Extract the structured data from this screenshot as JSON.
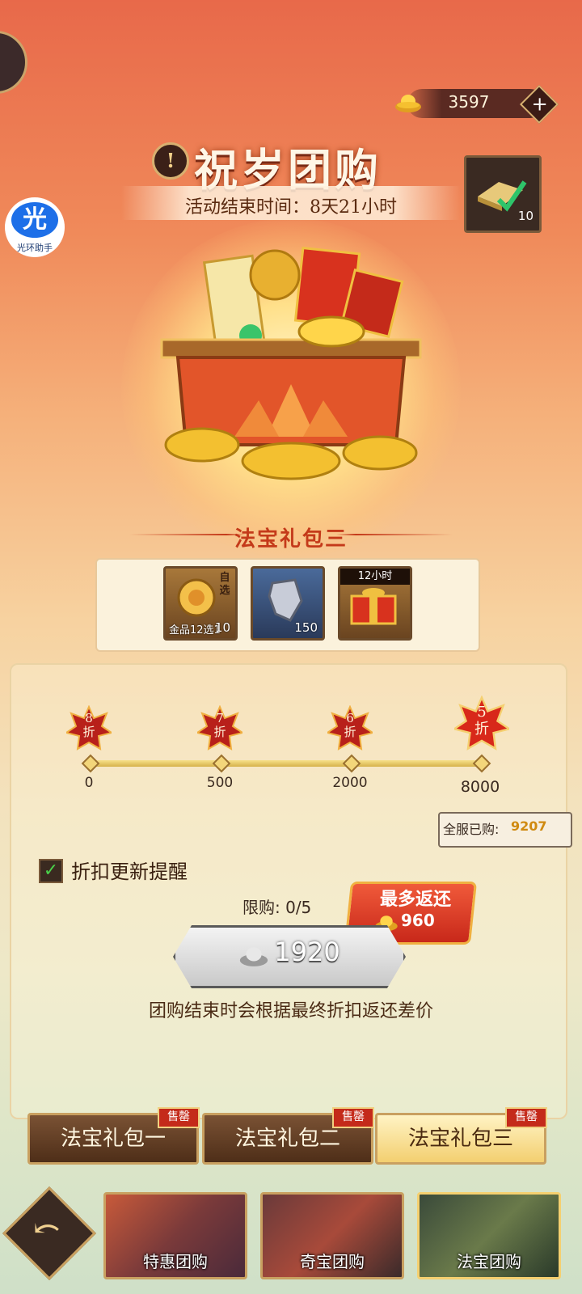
{
  "currency": {
    "value": "3597",
    "add_label": "+"
  },
  "header": {
    "info_label": "!",
    "title": "祝岁团购",
    "end_time": "活动结束时间：8天21小时"
  },
  "top_item": {
    "count": "10"
  },
  "assistant": {
    "icon_char": "光",
    "label": "光环助手"
  },
  "pack": {
    "title": "法宝礼包三",
    "items": [
      {
        "name": "gold-medal-selectable",
        "tag": "金品12选1",
        "corner": "自选",
        "count": "10"
      },
      {
        "name": "spirit-stone",
        "count": "150"
      },
      {
        "name": "red-gift-box",
        "top_label": "12小时"
      }
    ]
  },
  "discount": {
    "tiers": [
      {
        "rate": "8",
        "unit": "折",
        "threshold": "0"
      },
      {
        "rate": "7",
        "unit": "折",
        "threshold": "500"
      },
      {
        "rate": "6",
        "unit": "折",
        "threshold": "2000"
      },
      {
        "rate": "5",
        "unit": "折",
        "threshold": "8000"
      }
    ],
    "sold_label": "全服已购:",
    "sold_value": "9207"
  },
  "remind": {
    "checked": true,
    "label": "折扣更新提醒"
  },
  "purchase": {
    "limit": "限购: 0/5",
    "price": "1920",
    "refund_title": "最多返还",
    "refund_value": "960",
    "note": "团购结束时会根据最终折扣返还差价"
  },
  "pack_tabs": [
    {
      "label": "法宝礼包一",
      "badge": "售罄"
    },
    {
      "label": "法宝礼包二",
      "badge": "售罄"
    },
    {
      "label": "法宝礼包三",
      "badge": "售罄",
      "active": true
    }
  ],
  "nav_tabs": [
    {
      "label": "特惠团购"
    },
    {
      "label": "奇宝团购"
    },
    {
      "label": "法宝团购",
      "active": true
    }
  ],
  "colors": {
    "accent_red": "#c43a1a",
    "gold": "#f0b040",
    "sold_value": "#d08a10"
  }
}
